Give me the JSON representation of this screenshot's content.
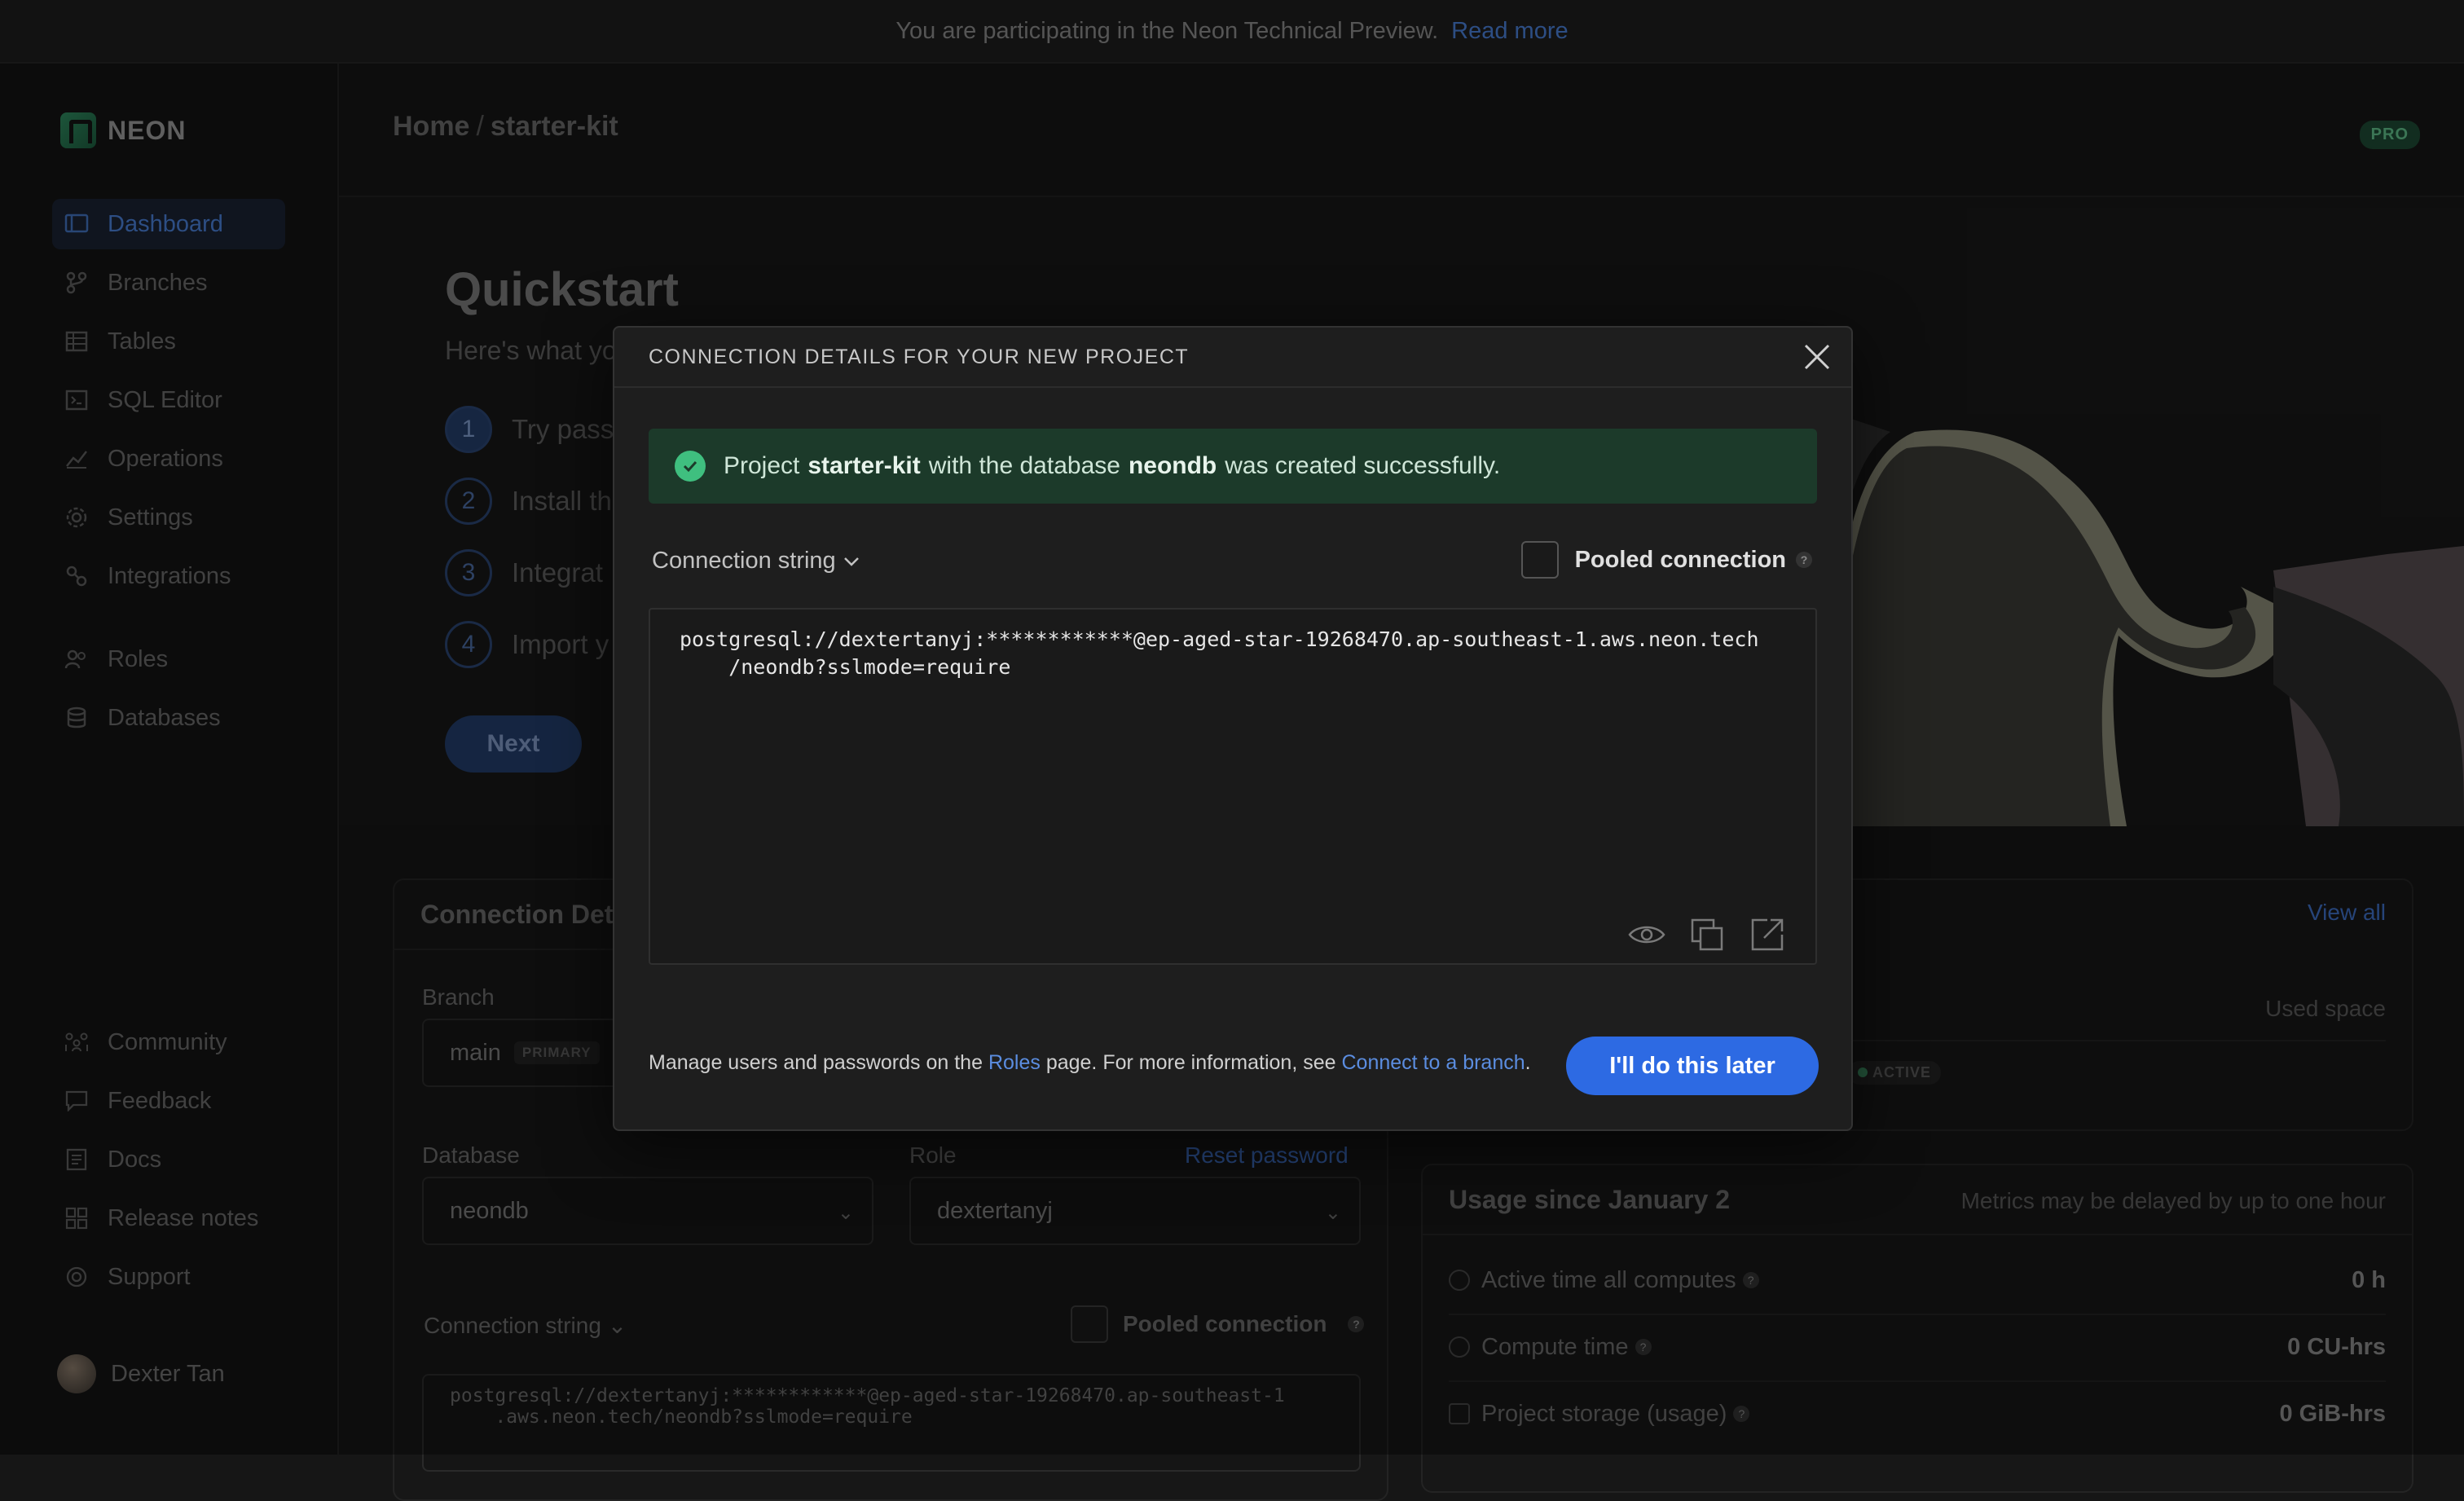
{
  "banner": {
    "text": "You are participating in the Neon Technical Preview.",
    "link": "Read more"
  },
  "sidebar": {
    "logo": "NEON",
    "items": [
      {
        "label": "Dashboard",
        "icon": "dashboard-icon"
      },
      {
        "label": "Branches",
        "icon": "branch-icon"
      },
      {
        "label": "Tables",
        "icon": "table-icon"
      },
      {
        "label": "SQL Editor",
        "icon": "sql-editor-icon"
      },
      {
        "label": "Operations",
        "icon": "operations-icon"
      },
      {
        "label": "Settings",
        "icon": "gear-icon"
      },
      {
        "label": "Integrations",
        "icon": "integrations-icon"
      },
      {
        "label": "Roles",
        "icon": "users-icon"
      },
      {
        "label": "Databases",
        "icon": "database-icon"
      }
    ],
    "bottom_items": [
      {
        "label": "Community",
        "icon": "community-icon"
      },
      {
        "label": "Feedback",
        "icon": "chat-icon"
      },
      {
        "label": "Docs",
        "icon": "docs-icon"
      },
      {
        "label": "Release notes",
        "icon": "release-notes-icon"
      },
      {
        "label": "Support",
        "icon": "support-icon"
      }
    ],
    "user": "Dexter Tan"
  },
  "header": {
    "crumb_home": "Home",
    "crumb_sep": "/",
    "crumb_project": "starter-kit",
    "badge": "PRO"
  },
  "quickstart": {
    "title": "Quickstart",
    "subtitle": "Here's what yo",
    "steps": [
      {
        "num": "1",
        "label": "Try pass"
      },
      {
        "num": "2",
        "label": "Install th"
      },
      {
        "num": "3",
        "label": "Integrat"
      },
      {
        "num": "4",
        "label": "Import y"
      }
    ],
    "next": "Next"
  },
  "conn_panel": {
    "title": "Connection Det",
    "branch_label": "Branch",
    "branch_value": "main",
    "branch_tag": "PRIMARY",
    "database_label": "Database",
    "database_value": "neondb",
    "role_label": "Role",
    "role_value": "dextertanyj",
    "reset_password": "Reset password",
    "conn_string_label": "Connection string",
    "pooled_label": "Pooled connection",
    "code_line1": "postgresql://dextertanyj:************@ep-aged-star-19268470.ap-southeast-1",
    "code_line2": "    .aws.neon.tech/neondb?sslmode=require"
  },
  "branches_panel": {
    "view_all": "View all",
    "col_compute": "ute",
    "col_used_space": "Used space",
    "status": "ACTIVE"
  },
  "usage": {
    "title": "Usage since January 2",
    "note": "Metrics may be delayed by up to one hour",
    "rows": [
      {
        "label": "Active time all computes",
        "value": "0 h"
      },
      {
        "label": "Compute time",
        "value": "0 CU-hrs"
      },
      {
        "label": "Project storage (usage)",
        "value": "0 GiB-hrs"
      }
    ]
  },
  "modal": {
    "title": "CONNECTION DETAILS FOR YOUR NEW PROJECT",
    "success_pre": "Project",
    "success_project": "starter-kit",
    "success_mid": "with the database",
    "success_db": "neondb",
    "success_post": "was created successfully.",
    "conn_string_label": "Connection string",
    "pooled_label": "Pooled connection",
    "code_line1": "postgresql://dextertanyj:************@ep-aged-star-19268470.ap-southeast-1.aws.neon.tech",
    "code_line2": "    /neondb?sslmode=require",
    "footer_pre": "Manage users and passwords on the",
    "footer_roles": "Roles",
    "footer_mid": "page. For more information, see",
    "footer_link": "Connect to a branch",
    "footer_end": ".",
    "later_button": "I'll do this later"
  },
  "colors": {
    "accent": "#2d6ae3",
    "success_bg": "#1c3a2a",
    "success_icon": "#3fbf7f",
    "brand": "#2f8a5f"
  }
}
